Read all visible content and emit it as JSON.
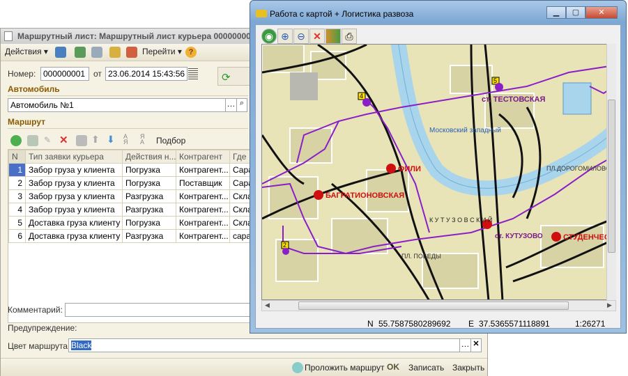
{
  "form": {
    "title": "Маршрутный лист: Маршрутный лист курьера 000000001",
    "toolbar": {
      "actions": "Действия ▾",
      "goto": "Перейти ▾",
      "help": "?"
    },
    "number_label": "Номер:",
    "number": "000000001",
    "from_label": "от",
    "date": "23.06.2014 15:43:56",
    "car_section": "Автомобиль",
    "car": "Автомобиль №1",
    "route_section": "Маршрут",
    "pick_label": "Подбор",
    "table": {
      "headers": [
        "N",
        "Тип заявки курьера",
        "Действия н...",
        "Контрагент",
        "Где"
      ],
      "rows": [
        [
          "1",
          "Забор груза у клиента",
          "Погрузка",
          "Контрагент...",
          "Сара"
        ],
        [
          "2",
          "Забор груза у клиента",
          "Погрузка",
          "Поставщик",
          "Сара"
        ],
        [
          "3",
          "Забор груза у клиента",
          "Разгрузка",
          "Контрагент...",
          "Скла"
        ],
        [
          "4",
          "Забор груза у клиента",
          "Разгрузка",
          "Контрагент...",
          "Скла"
        ],
        [
          "5",
          "Доставка груза клиенту",
          "Погрузка",
          "Контрагент...",
          "Скла"
        ],
        [
          "6",
          "Доставка груза клиенту",
          "Разгрузка",
          "Контрагент...",
          "сара"
        ]
      ]
    },
    "comment_label": "Комментарий:",
    "comment": "",
    "warning_label": "Предупреждение:",
    "color_label": "Цвет маршрута:",
    "color": "Black",
    "footer": {
      "route": "Проложить маршрут",
      "ok": "OK",
      "save": "Записать",
      "close": "Закрыть"
    }
  },
  "map": {
    "title": "Работа с картой + Логистика развоза",
    "labels": {
      "testovskaya": "ст. ТЕСТОВСКАЯ",
      "moskovsky": "Московский западный",
      "fili": "ФИЛИ",
      "bagration": "БАГРАТИОНОВСКАЯ",
      "dorogomil": "ПЛ.ДОРОГОМИЛОВСКАЯ",
      "kutuzovsky": "К У Т У З О В С К И Й",
      "kutuzovo": "ст. КУТУЗОВО",
      "student": "СТУДЕНЧЕС",
      "pobedy": "ПЛ. ПОБЕДЫ"
    },
    "markers": [
      "2",
      "4",
      "5"
    ],
    "status": {
      "n_label": "N",
      "n": "55.7587580289692",
      "e_label": "E",
      "e": "37.5365571118891",
      "scale": "1:26271"
    },
    "colors": {
      "route": "#8a1fc8",
      "river": "#a8d4ec",
      "land": "#e8e4b8",
      "metro": "#d01010"
    }
  }
}
